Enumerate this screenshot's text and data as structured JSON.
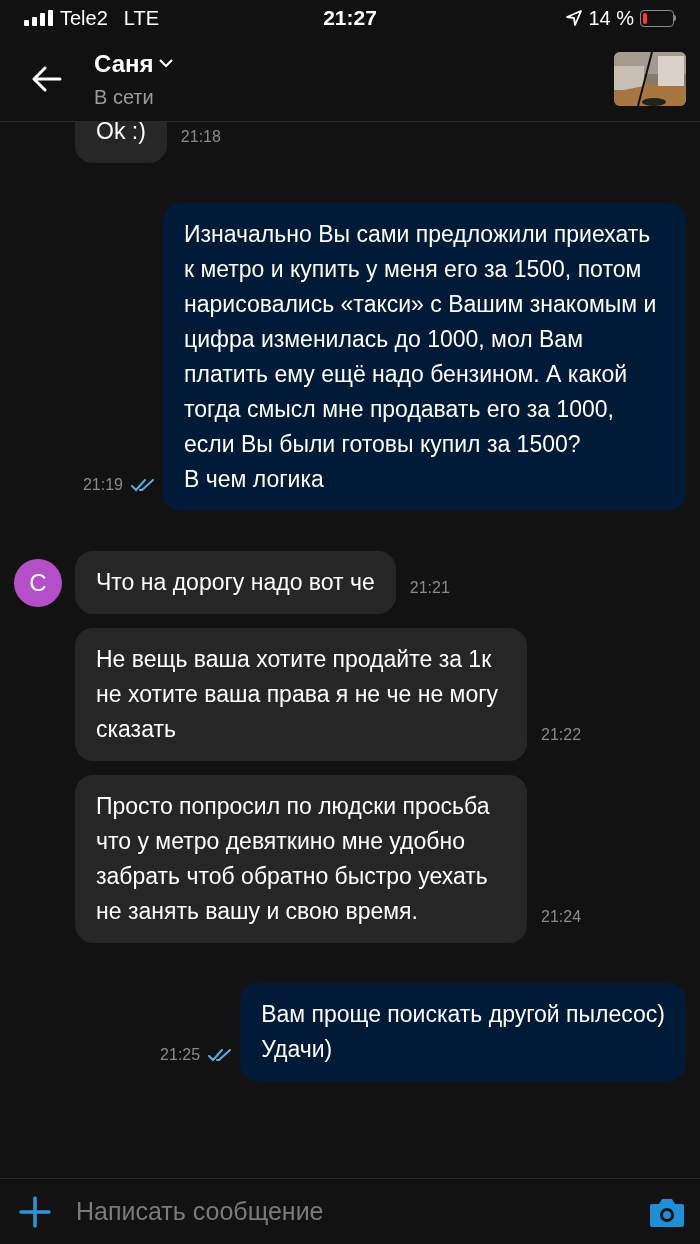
{
  "status_bar": {
    "carrier": "Tele2",
    "network": "LTE",
    "time": "21:27",
    "battery_text": "14 %"
  },
  "header": {
    "name": "Саня",
    "status": "В сети"
  },
  "messages": [
    {
      "kind": "incoming",
      "text": "Ok :)",
      "time": "21:18"
    },
    {
      "kind": "outgoing",
      "text": "Изначально Вы сами предложили приехать к метро и купить у меня его за 1500, потом нарисовались «такси» с Вашим знакомым и цифра изменилась до 1000, мол Вам платить ему ещё надо бензином. А какой тогда смысл мне продавать его за 1000, если Вы были готовы купил за 1500?\nВ чем логика",
      "time": "21:19",
      "read": true
    },
    {
      "kind": "incoming",
      "text": "Что на дорогу надо вот че",
      "time": "21:21",
      "avatar": "С"
    },
    {
      "kind": "incoming",
      "text": "Не вещь ваша хотите продайте за 1к не хотите ваша права я не че не могу сказать",
      "time": "21:22"
    },
    {
      "kind": "incoming",
      "text": "Просто попросил по людски просьба что у метро девяткино мне удобно забрать чтоб обратно быстро уехать не занять вашу и свою время.",
      "time": "21:24"
    },
    {
      "kind": "outgoing",
      "text": "Вам проще поискать другой пылесос)\nУдачи)",
      "time": "21:25",
      "read": true
    }
  ],
  "composer": {
    "placeholder": "Написать сообщение"
  }
}
